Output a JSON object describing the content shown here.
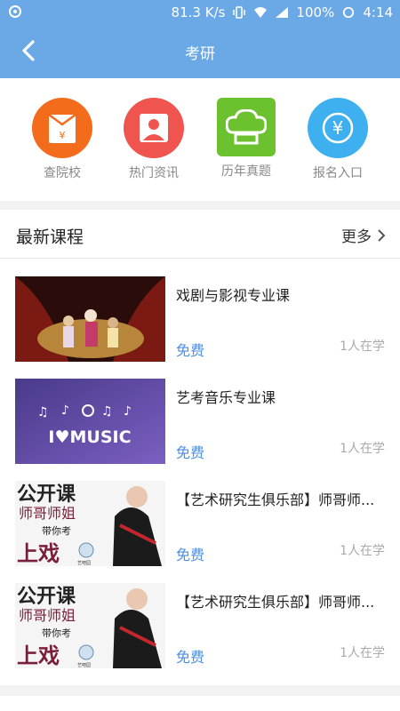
{
  "status_bar": {
    "network_speed": "81.3 K/s",
    "battery": "100%",
    "time": "4:14"
  },
  "header": {
    "title": "考研"
  },
  "quick_actions": [
    {
      "label": "查院校",
      "icon": "school-envelope-icon",
      "color": "#f36c1c"
    },
    {
      "label": "热门资讯",
      "icon": "user-news-icon",
      "color": "#f0544f"
    },
    {
      "label": "历年真题",
      "icon": "chef-hat-icon",
      "color": "#6cc22e"
    },
    {
      "label": "报名入口",
      "icon": "yen-coin-icon",
      "color": "#3fb0ef"
    }
  ],
  "latest_courses": {
    "title": "最新课程",
    "more_label": "更多",
    "items": [
      {
        "name": "戏剧与影视专业课",
        "price": "免费",
        "learners": "1人在学"
      },
      {
        "name": "艺考音乐专业课",
        "price": "免费",
        "learners": "1人在学",
        "thumb_text": "I♥MUSIC"
      },
      {
        "name": "【艺术研究生俱乐部】师哥师...",
        "price": "免费",
        "learners": "1人在学",
        "thumb_text": {
          "line1": "公开课",
          "line2": "师哥师姐",
          "line3": "带你考",
          "line4": "上戏",
          "brand": "艺吧园"
        }
      },
      {
        "name": "【艺术研究生俱乐部】师哥师...",
        "price": "免费",
        "learners": "1人在学",
        "thumb_text": {
          "line1": "公开课",
          "line2": "师哥师姐",
          "line3": "带你考",
          "line4": "上戏",
          "brand": "艺吧园"
        }
      }
    ]
  },
  "colors": {
    "primary": "#6aa9e6",
    "price": "#4a90e2"
  }
}
